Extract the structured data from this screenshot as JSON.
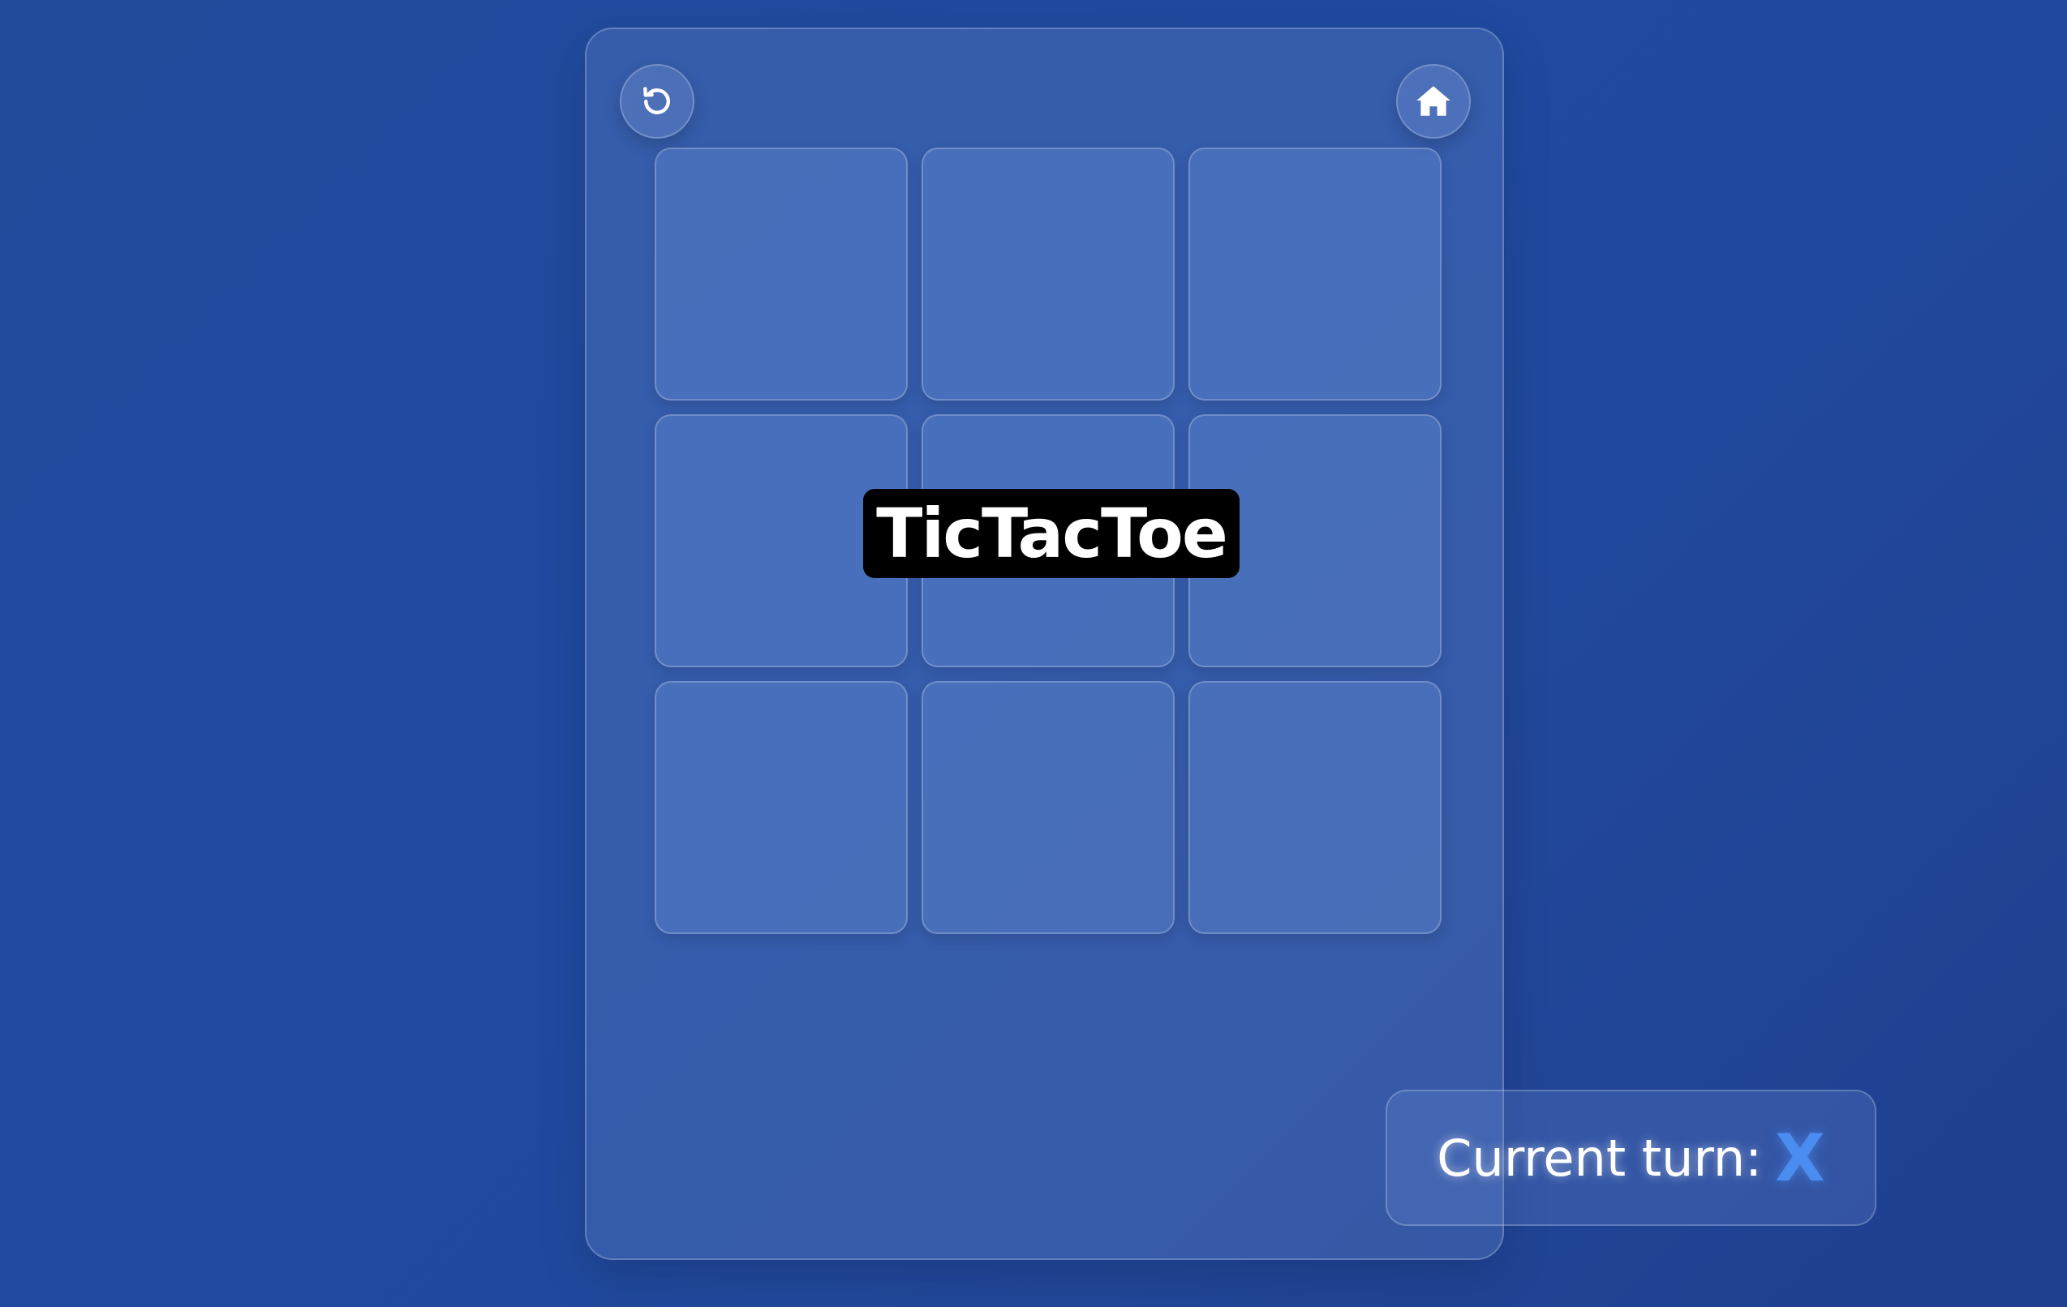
{
  "title": "TicTacToe",
  "toolbar": {
    "restart_icon": "restart-icon",
    "home_icon": "home-icon"
  },
  "board": {
    "cells": [
      "",
      "",
      "",
      "",
      "",
      "",
      "",
      "",
      ""
    ]
  },
  "status": {
    "label": "Current turn:",
    "player": "X",
    "player_color": "#4a8cf0"
  }
}
